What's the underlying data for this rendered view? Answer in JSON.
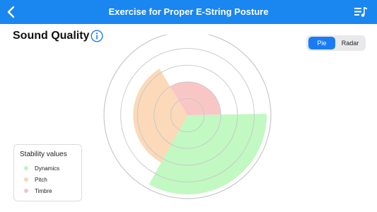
{
  "header": {
    "title": "Exercise for Proper E-String Posture",
    "back_icon": "chevron-left-icon",
    "list_icon": "music-list-icon",
    "bg_color": "#1a86ef"
  },
  "section": {
    "title": "Sound Quality",
    "info_icon": "info-icon"
  },
  "view_toggle": {
    "options": [
      "Pie",
      "Radar"
    ],
    "selected": "Pie"
  },
  "legend": {
    "title": "Stability values",
    "items": [
      {
        "label": "Dynamics",
        "color": "#bdf7bd"
      },
      {
        "label": "Pitch",
        "color": "#fbd6b3"
      },
      {
        "label": "Timbre",
        "color": "#f9c1c1"
      }
    ]
  },
  "chart_data": {
    "type": "pie",
    "variant": "polar-area",
    "rings": 5,
    "series": [
      {
        "name": "Dynamics",
        "value": 0.95,
        "color": "#bdf7bd"
      },
      {
        "name": "Pitch",
        "value": 0.65,
        "color": "#fbd6b3"
      },
      {
        "name": "Timbre",
        "value": 0.4,
        "color": "#f9c1c1"
      }
    ]
  }
}
